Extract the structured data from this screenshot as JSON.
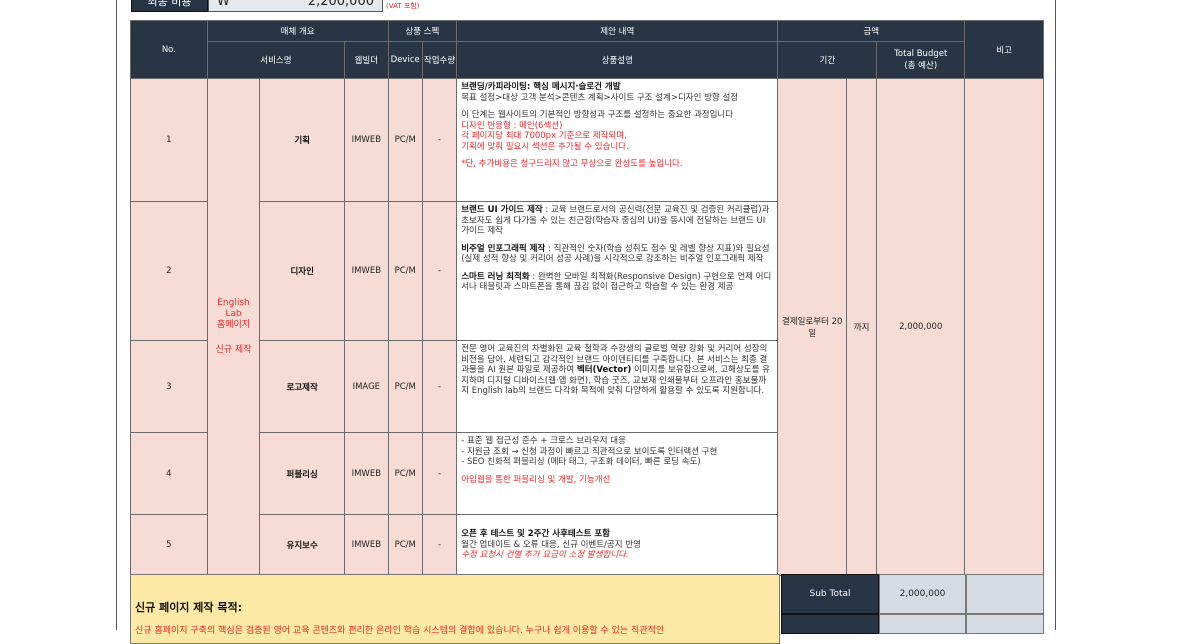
{
  "top": {
    "label": "최종 비용",
    "currency": "W",
    "amount": "2,200,000",
    "vat_note": "(VAT 포함)"
  },
  "headers": {
    "no": "No.",
    "media_overview": "매체 개요",
    "product_spec": "상품 스펙",
    "proposal": "제안 내역",
    "amount": "금액",
    "remarks": "비고",
    "service_name": "서비스명",
    "web_builder": "웹빌더",
    "device": "Device",
    "work_qty": "작업수량",
    "product_desc": "상품설명",
    "period": "기간",
    "total_budget": "Total Budget",
    "total_budget_sub": "(총 예산)"
  },
  "service": {
    "name_line1": "English",
    "name_line2": "Lab",
    "name_line3": "홈페이지",
    "type": "신규 제작"
  },
  "period": {
    "from": "결제일로부터 20일",
    "to": "까지"
  },
  "budget": "2,000,000",
  "rows": [
    {
      "no": "1",
      "category": "기획",
      "builder": "IMWEB",
      "device": "PC/M",
      "qty": "-",
      "d1_title": "브랜딩/카피라이팅: 핵심 메시지·슬로건 개발",
      "d1_text": "목표 설정>대상 고객 분석>콘텐츠 계획>사이트 구조 설계>디자인 방향 설정",
      "d2_text": "이 단계는 웹사이트의 기본적인 방향성과 구조를 설정하는 중요한 과정입니다",
      "d3_red1": "디자인 반응형 : 메인(6섹션)",
      "d3_red2": "각 페이지당 최대 7000px 기준으로 제작되며,",
      "d3_red3": "기획에 맞춰 필요시 섹션은 추가될 수 있습니다.",
      "d4_red": "*단, 추가비용은 청구드리지 않고 무상으로 완성도를 높입니다."
    },
    {
      "no": "2",
      "category": "디자인",
      "builder": "IMWEB",
      "device": "PC/M",
      "qty": "-",
      "p1_title": "브랜드 UI 가이드 제작",
      "p1_text": " : 교육 브랜드로서의 공신력(전문 교육진 및 검증된 커리큘럼)과 초보자도 쉽게 다가올 수 있는 친근함(학습자 중심의 UI)을 동시에 전달하는 브랜드 UI 가이드 제작",
      "p2_title": "비주얼 인포그래픽 제작",
      "p2_text": " : 직관적인 숫자(학습 성취도 점수 및 레벨 향상 지표)와 필요성(실제 성적 향상 및 커리어 성공 사례)을 시각적으로 강조하는 비주얼 인포그래픽 제작",
      "p3_title": "스마트 러닝 최적화",
      "p3_text": " : 완벽한 모바일 최적화(Responsive Design) 구현으로 언제 어디서나 태블릿과 스마트폰을 통해 끊김 없이 접근하고 학습할 수 있는 환경 제공"
    },
    {
      "no": "3",
      "category": "로고제작",
      "builder": "IMAGE",
      "device": "PC/M",
      "qty": "-",
      "t1": "전문 영어 교육진의 차별화된 교육 철학과 수강생의 글로벌 역량 강화 및 커리어 성장의 비전을 담아, 세련되고 감각적인 브랜드 아이덴티티를 구축합니다. 본 서비스는 최종 결과물을 AI 원본 파일로 제공하여 ",
      "t1_bold": "벡터(Vector)",
      "t2": " 이미지를 보유함으로써, 고해상도를 유지하며 디지털 디바이스(웹·앱 화면), 학습 굿즈, 교보재 인쇄물부터 오프라인 홍보물까지 English lab의 브랜드 다각화 목적에 맞춰 다양하게 활용할 수 있도록 지원합니다."
    },
    {
      "no": "4",
      "category": "퍼블리싱",
      "builder": "IMWEB",
      "device": "PC/M",
      "qty": "-",
      "l1": "- 표준 웹 접근성 준수 + 크로스 브라우저 대응",
      "l2": "- 지원금 조회 → 신청 과정이 빠르고 직관적으로 보이도록 인터랙션 구현",
      "l3": "- SEO 친화적 퍼블리싱 (메타 태그, 구조화 데이터, 빠른 로딩 속도)",
      "red": "아임웹을 통한 퍼블리싱 및 개발, 기능개선"
    },
    {
      "no": "5",
      "category": "유지보수",
      "builder": "IMWEB",
      "device": "PC/M",
      "qty": "-",
      "title": "오픈 후 테스트 및 2주간 사후테스트 포함",
      "text": "월간 업데이트 & 오류 대응, 신규 이벤트/공지 반영",
      "red": "수정 요청시 건별 추가 요금이 소정 발생합니다."
    }
  ],
  "bottom": {
    "purpose_title": "신규 페이지 제작 목적:",
    "purpose_text": "신규 홈페이지 구축의 핵심은 검증된 영어 교육 콘텐츠와 편리한 온라인 학습 시스템의 결합에 있습니다. 누구나 쉽게 이용할 수 있는 직관적인",
    "subtotal_label": "Sub Total",
    "subtotal_value": "2,000,000"
  }
}
